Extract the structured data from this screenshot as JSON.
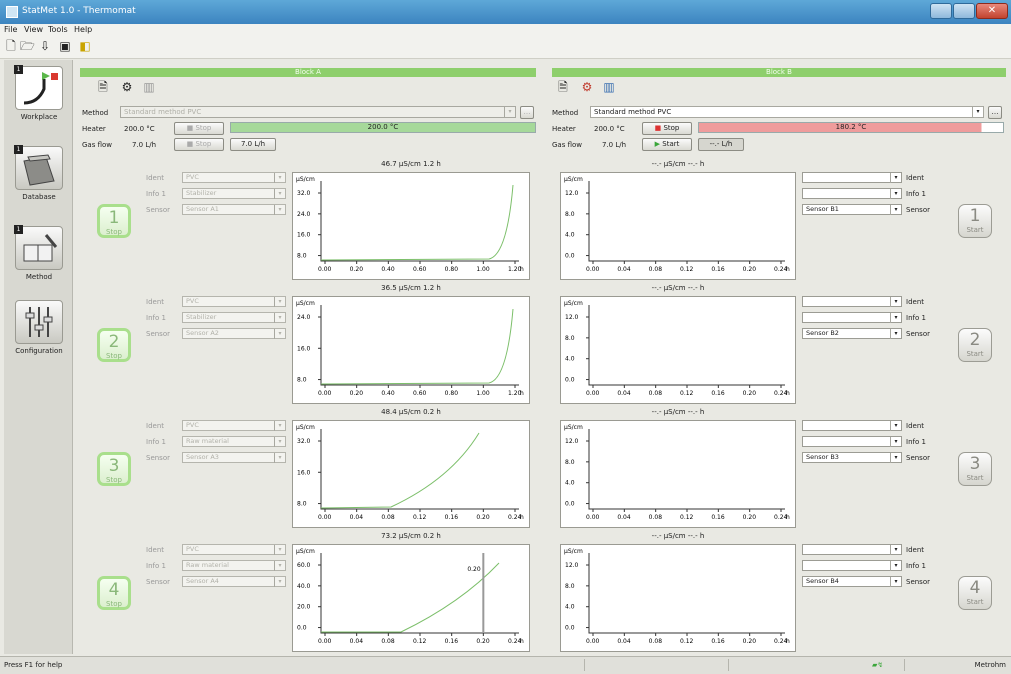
{
  "window": {
    "title": "StatMet 1.0 - Thermomat",
    "close_icon": "close-icon"
  },
  "menu": [
    "File",
    "View",
    "Tools",
    "Help"
  ],
  "sidebar": [
    {
      "label": "Workplace",
      "icon": "workplace-icon"
    },
    {
      "label": "Database",
      "icon": "database-icon"
    },
    {
      "label": "Method",
      "icon": "method-icon"
    },
    {
      "label": "Configuration",
      "icon": "configuration-icon"
    }
  ],
  "block_a": {
    "header": "Block A",
    "method_label": "Method",
    "method_value": "Standard method PVC",
    "heater_label": "Heater",
    "heater_temp": "200.0 °C",
    "heater_stop": "Stop",
    "heater_current": "200.0 °C",
    "gasflow_label": "Gas flow",
    "gasflow_value": "7.0 L/h",
    "gasflow_stop": "Stop",
    "gasflow_current": "7.0 L/h",
    "ident_label": "Ident",
    "info_label": "Info 1",
    "sensor_label": "Sensor",
    "cells": [
      {
        "num": "1",
        "btn": "Stop",
        "ident": "PVC",
        "info": "Stabilizer",
        "sensor": "Sensor A1",
        "readout": "46.7 µS/cm   1.2 h",
        "y_unit": "µS/cm",
        "y_ticks": [
          "32.0",
          "24.0",
          "16.0",
          "8.0"
        ],
        "x_ticks": [
          "0.00",
          "0.20",
          "0.40",
          "0.60",
          "0.80",
          "1.00",
          "1.20"
        ],
        "x_unit": "h"
      },
      {
        "num": "2",
        "btn": "Stop",
        "ident": "PVC",
        "info": "Stabilizer",
        "sensor": "Sensor A2",
        "readout": "36.5 µS/cm   1.2 h",
        "y_unit": "µS/cm",
        "y_ticks": [
          "24.0",
          "16.0",
          "8.0"
        ],
        "x_ticks": [
          "0.00",
          "0.20",
          "0.40",
          "0.60",
          "0.80",
          "1.00",
          "1.20"
        ],
        "x_unit": "h"
      },
      {
        "num": "3",
        "btn": "Stop",
        "ident": "PVC",
        "info": "Raw material",
        "sensor": "Sensor A3",
        "readout": "48.4 µS/cm   0.2 h",
        "y_unit": "µS/cm",
        "y_ticks": [
          "32.0",
          "16.0",
          "8.0"
        ],
        "x_ticks": [
          "0.00",
          "0.04",
          "0.08",
          "0.12",
          "0.16",
          "0.20",
          "0.24"
        ],
        "x_unit": "h"
      },
      {
        "num": "4",
        "btn": "Stop",
        "ident": "PVC",
        "info": "Raw material",
        "sensor": "Sensor A4",
        "readout": "73.2 µS/cm   0.2 h",
        "y_unit": "µS/cm",
        "y_ticks": [
          "60.0",
          "40.0",
          "20.0",
          "0.0"
        ],
        "x_ticks": [
          "0.00",
          "0.04",
          "0.08",
          "0.12",
          "0.16",
          "0.20",
          "0.24"
        ],
        "x_unit": "h",
        "marker": "0.20"
      }
    ]
  },
  "block_b": {
    "header": "Block B",
    "method_label": "Method",
    "method_value": "Standard method PVC",
    "heater_label": "Heater",
    "heater_temp": "200.0 °C",
    "heater_stop": "Stop",
    "heater_current": "180.2 °C",
    "gasflow_label": "Gas flow",
    "gasflow_value": "7.0 L/h",
    "gasflow_start": "Start",
    "gasflow_current": "--.- L/h",
    "ident_label": "Ident",
    "info_label": "Info 1",
    "sensor_label": "Sensor",
    "cells": [
      {
        "num": "1",
        "btn": "Start",
        "sensor": "Sensor B1",
        "readout": "--.- µS/cm   --.- h",
        "y_unit": "µS/cm",
        "y_ticks": [
          "12.0",
          "8.0",
          "4.0",
          "0.0"
        ],
        "x_ticks": [
          "0.00",
          "0.04",
          "0.08",
          "0.12",
          "0.16",
          "0.20",
          "0.24"
        ],
        "x_unit": "h"
      },
      {
        "num": "2",
        "btn": "Start",
        "sensor": "Sensor B2",
        "readout": "--.- µS/cm   --.- h",
        "y_unit": "µS/cm",
        "y_ticks": [
          "12.0",
          "8.0",
          "4.0",
          "0.0"
        ],
        "x_ticks": [
          "0.00",
          "0.04",
          "0.08",
          "0.12",
          "0.16",
          "0.20",
          "0.24"
        ],
        "x_unit": "h"
      },
      {
        "num": "3",
        "btn": "Start",
        "sensor": "Sensor B3",
        "readout": "--.- µS/cm   --.- h",
        "y_unit": "µS/cm",
        "y_ticks": [
          "12.0",
          "8.0",
          "4.0",
          "0.0"
        ],
        "x_ticks": [
          "0.00",
          "0.04",
          "0.08",
          "0.12",
          "0.16",
          "0.20",
          "0.24"
        ],
        "x_unit": "h"
      },
      {
        "num": "4",
        "btn": "Start",
        "sensor": "Sensor B4",
        "readout": "--.- µS/cm   --.- h",
        "y_unit": "µS/cm",
        "y_ticks": [
          "12.0",
          "8.0",
          "4.0",
          "0.0"
        ],
        "x_ticks": [
          "0.00",
          "0.04",
          "0.08",
          "0.12",
          "0.16",
          "0.20",
          "0.24"
        ],
        "x_unit": "h"
      }
    ]
  },
  "status": {
    "help": "Press F1 for help",
    "mode": "Metrohm"
  },
  "colors": {
    "accent_green": "#8ecf6c",
    "heater_ok": "#a6d99a",
    "heater_hot": "#ef9c9c",
    "curve": "#7cbf6a"
  }
}
